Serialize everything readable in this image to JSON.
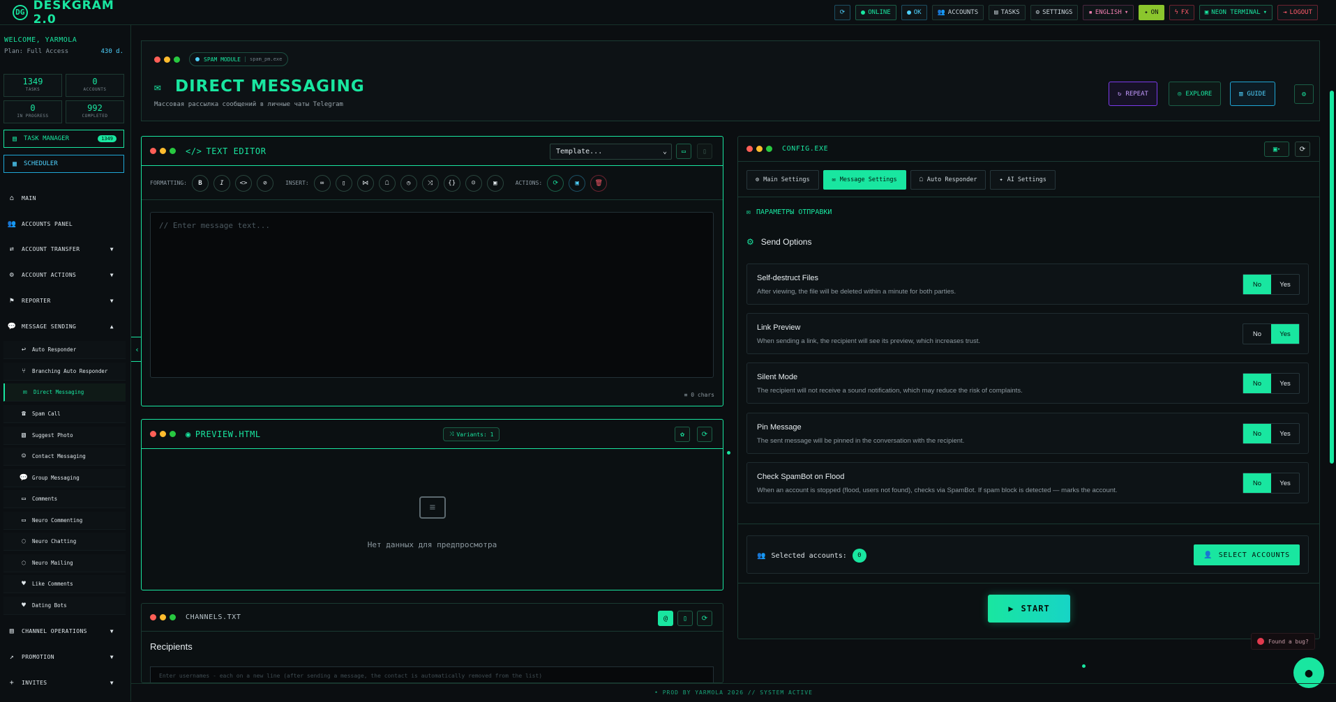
{
  "brand": {
    "name": "DESKGRAM 2.0",
    "logo_text": "DG"
  },
  "topbar": {
    "online": "ONLINE",
    "ok": "OK",
    "accounts": "ACCOUNTS",
    "tasks": "TASKS",
    "settings": "SETTINGS",
    "language": "ENGLISH",
    "on": "ON",
    "fx": "FX",
    "theme": "NEON TERMINAL",
    "logout": "LOGOUT"
  },
  "sidebar": {
    "welcome": "WELCOME, YARMOLA",
    "plan": "Plan: Full Access",
    "days": "430 d.",
    "stats": [
      {
        "value": "1349",
        "label": "TASKS"
      },
      {
        "value": "0",
        "label": "ACCOUNTS"
      },
      {
        "value": "0",
        "label": "IN PROGRESS"
      },
      {
        "value": "992",
        "label": "COMPLETED"
      }
    ],
    "task_manager": "TASK MANAGER",
    "task_manager_badge": "1349",
    "scheduler": "SCHEDULER",
    "nav": [
      {
        "label": "MAIN"
      },
      {
        "label": "ACCOUNTS PANEL"
      },
      {
        "label": "ACCOUNT TRANSFER"
      },
      {
        "label": "ACCOUNT ACTIONS"
      },
      {
        "label": "REPORTER"
      },
      {
        "label": "MESSAGE SENDING"
      }
    ],
    "sub": [
      "Auto Responder",
      "Branching Auto Responder",
      "Direct Messaging",
      "Spam Call",
      "Suggest Photo",
      "Contact Messaging",
      "Group Messaging",
      "Comments",
      "Neuro Commenting",
      "Neuro Chatting",
      "Neuro Mailing",
      "Like Comments",
      "Dating Bots"
    ],
    "nav_bottom": [
      {
        "label": "CHANNEL OPERATIONS"
      },
      {
        "label": "PROMOTION"
      },
      {
        "label": "INVITES"
      }
    ]
  },
  "header": {
    "module": "SPAM MODULE",
    "module_file": "spam_pm.exe",
    "title": "DIRECT MESSAGING",
    "subtitle": "Массовая рассылка сообщений в личные чаты Telegram",
    "repeat": "REPEAT",
    "explore": "EXPLORE",
    "guide": "GUIDE"
  },
  "editor": {
    "title": "TEXT EDITOR",
    "template_placeholder": "Template...",
    "formatting_label": "FORMATTING:",
    "insert_label": "INSERT:",
    "actions_label": "ACTIONS:",
    "placeholder": "// Enter message text...",
    "chars": "0 chars"
  },
  "preview": {
    "title": "PREVIEW.HTML",
    "variants": "Variants: 1",
    "empty": "Нет данных для предпросмотра"
  },
  "channels": {
    "title": "CHANNELS.TXT",
    "recipients": "Recipients",
    "hint": "Enter usernames - each on a new line (after sending a message, the contact is automatically removed from the list)"
  },
  "config": {
    "title": "CONFIG.EXE",
    "tabs": [
      "Main Settings",
      "Message Settings",
      "Auto Responder",
      "AI Settings"
    ],
    "section": "ПАРАМЕТРЫ ОТПРАВКИ",
    "send_options": "Send Options",
    "options": [
      {
        "title": "Self-destruct Files",
        "desc": "After viewing, the file will be deleted within a minute for both parties.",
        "value": "No"
      },
      {
        "title": "Link Preview",
        "desc": "When sending a link, the recipient will see its preview, which increases trust.",
        "value": "Yes"
      },
      {
        "title": "Silent Mode",
        "desc": "The recipient will not receive a sound notification, which may reduce the risk of complaints.",
        "value": "No"
      },
      {
        "title": "Pin Message",
        "desc": "The sent message will be pinned in the conversation with the recipient.",
        "value": "No"
      },
      {
        "title": "Check SpamBot on Flood",
        "desc": "When an account is stopped (flood, users not found), checks via SpamBot. If spam block is detected — marks the account.",
        "value": "No"
      }
    ],
    "no": "No",
    "yes": "Yes",
    "selected_accounts": "Selected accounts:",
    "selected_count": "0",
    "select_button": "SELECT ACCOUNTS",
    "start": "START"
  },
  "found_bug": "Found a bug?",
  "footer": "• PROD BY YARMOLA 2026   // SYSTEM ACTIVE"
}
